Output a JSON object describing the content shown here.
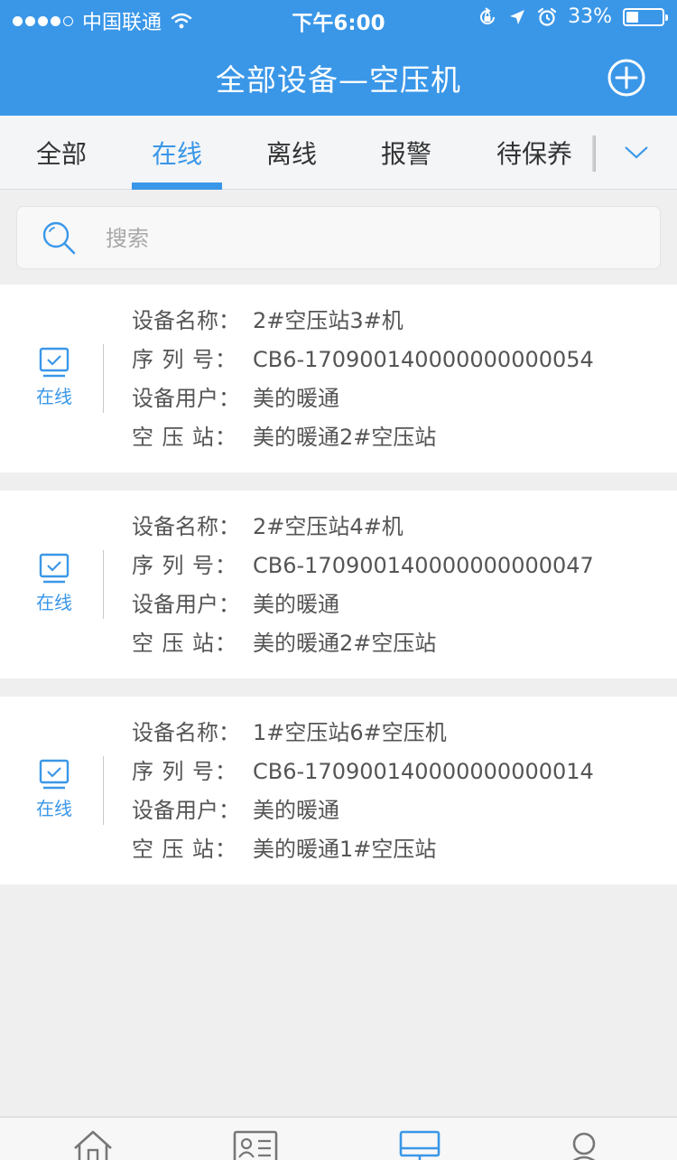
{
  "status_bar": {
    "carrier": "中国联通",
    "time": "下午6:00",
    "battery": "33%",
    "battery_level": 0.33
  },
  "header": {
    "title": "全部设备—空压机"
  },
  "tabs": [
    {
      "label": "全部",
      "active": false
    },
    {
      "label": "在线",
      "active": true
    },
    {
      "label": "离线",
      "active": false
    },
    {
      "label": "报警",
      "active": false
    },
    {
      "label": "待保养",
      "active": false
    }
  ],
  "search": {
    "placeholder": "搜索"
  },
  "field_labels": {
    "name": "设备名称：",
    "serial": "序 列 号：",
    "user": "设备用户：",
    "station": "空 压 站："
  },
  "devices": [
    {
      "status": "在线",
      "name": "2#空压站3#机",
      "serial": "CB6-170900140000000000054",
      "user": "美的暖通",
      "station": "美的暖通2#空压站"
    },
    {
      "status": "在线",
      "name": "2#空压站4#机",
      "serial": "CB6-170900140000000000047",
      "user": "美的暖通",
      "station": "美的暖通2#空压站"
    },
    {
      "status": "在线",
      "name": "1#空压站6#空压机",
      "serial": "CB6-170900140000000000014",
      "user": "美的暖通",
      "station": "美的暖通1#空压站"
    }
  ],
  "colors": {
    "primary": "#3a97e8",
    "text": "#555555"
  },
  "icons": {
    "add": "plus-circle-icon",
    "search": "search-icon",
    "tabs_more": "chevron-down-icon",
    "device": "monitor-check-icon",
    "bottom_nav": [
      "home-icon",
      "contact-card-icon",
      "monitor-icon",
      "user-icon"
    ]
  }
}
